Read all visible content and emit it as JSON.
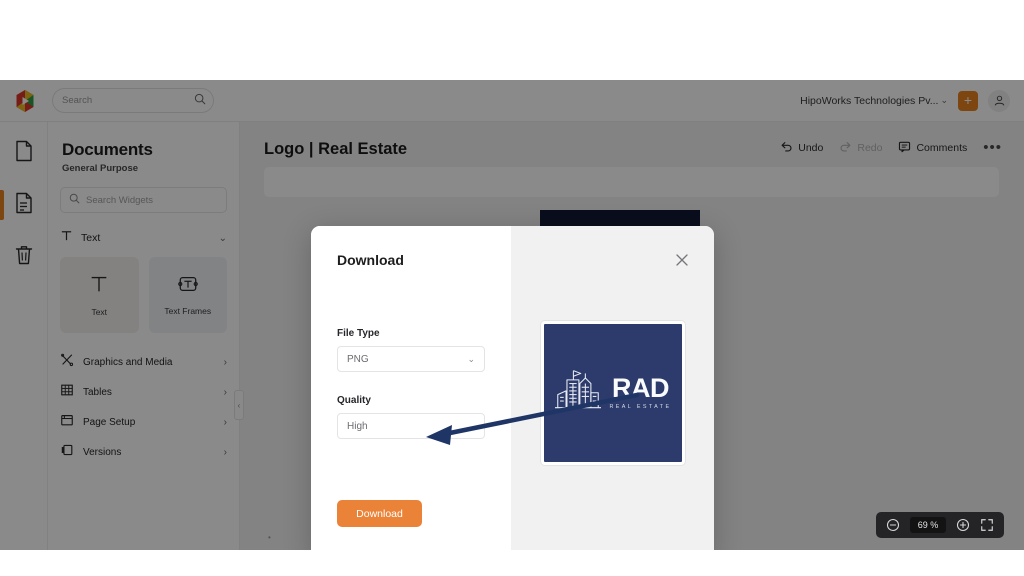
{
  "topbar": {
    "logo_icon": "app-logo-icon",
    "search": {
      "placeholder": "Search",
      "value": "",
      "icon": "search-icon"
    },
    "org_name": "HipoWorks Technologies Pv...",
    "org_chevron": "⌄",
    "add_label": "+",
    "account_icon": "user-avatar-icon"
  },
  "rail": {
    "items": [
      {
        "name": "documents-blank",
        "icon": "document-blank-icon",
        "active": false
      },
      {
        "name": "documents-list",
        "icon": "document-lines-icon",
        "active": true
      },
      {
        "name": "trash",
        "icon": "trash-icon",
        "active": false
      }
    ]
  },
  "panel": {
    "title": "Documents",
    "subtitle": "General Purpose",
    "search": {
      "placeholder": "Search Widgets",
      "value": "",
      "icon": "search-icon"
    },
    "section": {
      "label": "Text",
      "icon": "text-t-icon",
      "chevron": "⌄"
    },
    "cards": [
      {
        "label": "Text",
        "icon": "text-t-icon",
        "state": "hover"
      },
      {
        "label": "Text Frames",
        "icon": "text-frame-icon",
        "state": "default"
      }
    ],
    "menu": [
      {
        "label": "Graphics and Media",
        "icon": "graphics-media-icon",
        "arrow": "›"
      },
      {
        "label": "Tables",
        "icon": "table-grid-icon",
        "arrow": "›"
      },
      {
        "label": "Page Setup",
        "icon": "page-setup-icon",
        "arrow": "›"
      },
      {
        "label": "Versions",
        "icon": "versions-icon",
        "arrow": "›"
      }
    ],
    "collapse_handle": "‹"
  },
  "document": {
    "title": "Logo | Real Estate",
    "actions": [
      {
        "label": "Undo",
        "icon": "undo-arrow-icon",
        "disabled": false
      },
      {
        "label": "Redo",
        "icon": "redo-arrow-icon",
        "disabled": true
      },
      {
        "label": "Comments",
        "icon": "comment-bubble-icon",
        "disabled": false
      }
    ],
    "overflow_menu": "•••",
    "artboard_subtitle": "REAL ESTATE",
    "scroll_marker": "•"
  },
  "zoom_control": {
    "minus_icon": "zoom-out-icon",
    "value": "69 %",
    "plus_icon": "zoom-in-icon",
    "fullscreen_icon": "fullscreen-icon"
  },
  "modal": {
    "title": "Download",
    "close_icon": "close-icon",
    "fields": [
      {
        "label": "File Type",
        "value": "PNG",
        "chevron": "⌄",
        "options": [
          "PNG"
        ]
      },
      {
        "label": "Quality",
        "value": "High",
        "chevron": "⌄",
        "options": [
          "High"
        ]
      }
    ],
    "primary_button": "Download",
    "preview": {
      "brand": "RAD",
      "tagline": "REAL ESTATE",
      "icon": "city-skyline-icon",
      "background_color": "#2c3b6b"
    }
  },
  "annotation": {
    "arrow_color": "#1f3566",
    "points_to": "download-button"
  },
  "colors": {
    "accent_orange": "#e8811f",
    "button_orange": "#ea8338",
    "brand_navy": "#2c3b6b",
    "artboard_navy": "#131b34",
    "app_background": "#f4f4f5",
    "scrim": "rgba(0,0,0,0.46)"
  }
}
